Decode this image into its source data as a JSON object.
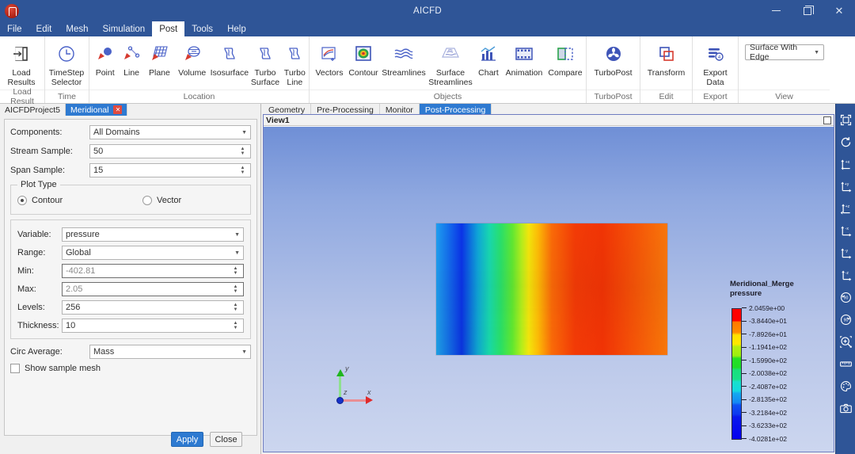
{
  "window": {
    "title": "AICFD",
    "logo_icon": "app-logo-icon",
    "minimize_label": "Minimize",
    "maximize_label": "Restore",
    "close_label": "Close"
  },
  "menubar": {
    "items": [
      {
        "label": "File",
        "active": false
      },
      {
        "label": "Edit",
        "active": false
      },
      {
        "label": "Mesh",
        "active": false
      },
      {
        "label": "Simulation",
        "active": false
      },
      {
        "label": "Post",
        "active": true
      },
      {
        "label": "Tools",
        "active": false
      },
      {
        "label": "Help",
        "active": false
      }
    ]
  },
  "ribbon": {
    "groups": [
      {
        "label": "Load Result",
        "buttons": [
          {
            "label": "Load\nResults",
            "label_l1": "Load",
            "label_l2": "Results",
            "icon": "load-results-icon"
          }
        ]
      },
      {
        "label": "Time",
        "buttons": [
          {
            "label_l1": "TimeStep",
            "label_l2": "Selector",
            "icon": "timestep-selector-icon"
          }
        ]
      },
      {
        "label": "Location",
        "buttons": [
          {
            "label_l1": "Point",
            "label_l2": "",
            "icon": "point-icon"
          },
          {
            "label_l1": "Line",
            "label_l2": "",
            "icon": "line-icon"
          },
          {
            "label_l1": "Plane",
            "label_l2": "",
            "icon": "plane-icon"
          },
          {
            "label_l1": "Volume",
            "label_l2": "",
            "icon": "volume-icon"
          },
          {
            "label_l1": "Isosurface",
            "label_l2": "",
            "icon": "isosurface-icon"
          },
          {
            "label_l1": "Turbo",
            "label_l2": "Surface",
            "icon": "turbo-surface-icon"
          },
          {
            "label_l1": "Turbo",
            "label_l2": "Line",
            "icon": "turbo-line-icon"
          }
        ]
      },
      {
        "label": "Objects",
        "buttons": [
          {
            "label_l1": "Vectors",
            "label_l2": "",
            "icon": "vectors-icon"
          },
          {
            "label_l1": "Contour",
            "label_l2": "",
            "icon": "contour-icon"
          },
          {
            "label_l1": "Streamlines",
            "label_l2": "",
            "icon": "streamlines-icon"
          },
          {
            "label_l1": "Surface",
            "label_l2": "Streamlines",
            "icon": "surface-streamlines-icon"
          },
          {
            "label_l1": "Chart",
            "label_l2": "",
            "icon": "chart-icon"
          },
          {
            "label_l1": "Animation",
            "label_l2": "",
            "icon": "animation-icon"
          },
          {
            "label_l1": "Compare",
            "label_l2": "",
            "icon": "compare-icon"
          }
        ]
      },
      {
        "label": "TurboPost",
        "buttons": [
          {
            "label_l1": "TurboPost",
            "label_l2": "",
            "icon": "turbopost-icon"
          }
        ]
      },
      {
        "label": "Edit",
        "buttons": [
          {
            "label_l1": "Transform",
            "label_l2": "",
            "icon": "transform-icon"
          }
        ]
      },
      {
        "label": "Export",
        "buttons": [
          {
            "label_l1": "Export",
            "label_l2": "Data",
            "icon": "export-data-icon"
          }
        ]
      },
      {
        "label": "View",
        "buttons": [],
        "select": {
          "value": "Surface With Edge",
          "caret_icon": "chevron-down-icon"
        }
      }
    ]
  },
  "left_panel": {
    "tabs": [
      {
        "label": "AICFDProject5",
        "active": false,
        "closable": false
      },
      {
        "label": "Meridional",
        "active": true,
        "closable": true,
        "close_icon": "close-icon"
      }
    ],
    "fields": [
      {
        "name": "components",
        "label": "Components:",
        "value": "All Domains",
        "type": "combo"
      },
      {
        "name": "stream-sample",
        "label": "Stream Sample:",
        "value": "50",
        "type": "spin"
      },
      {
        "name": "span-sample",
        "label": "Span Sample:",
        "value": "15",
        "type": "spin"
      }
    ],
    "plot_type": {
      "legend": "Plot Type",
      "options": [
        {
          "label": "Contour",
          "selected": true
        },
        {
          "label": "Vector",
          "selected": false
        }
      ]
    },
    "contour_fields": [
      {
        "name": "variable",
        "label": "Variable:",
        "value": "pressure",
        "type": "combo"
      },
      {
        "name": "range",
        "label": "Range:",
        "value": "Global",
        "type": "combo"
      },
      {
        "name": "min",
        "label": "Min:",
        "value": "-402.81",
        "type": "spin",
        "dim": true
      },
      {
        "name": "max",
        "label": "Max:",
        "value": "2.05",
        "type": "spin",
        "dim": true
      },
      {
        "name": "levels",
        "label": "Levels:",
        "value": "256",
        "type": "spin"
      },
      {
        "name": "thickness",
        "label": "Thickness:",
        "value": "10",
        "type": "spin"
      }
    ],
    "circ_average": {
      "label": "Circ Average:",
      "value": "Mass",
      "type": "combo"
    },
    "show_sample_mesh": {
      "label": "Show sample mesh",
      "checked": false
    },
    "buttons": {
      "apply": "Apply",
      "close": "Close"
    }
  },
  "viewport": {
    "tabs": [
      {
        "label": "Geometry",
        "active": false
      },
      {
        "label": "Pre-Processing",
        "active": false
      },
      {
        "label": "Monitor",
        "active": false
      },
      {
        "label": "Post-Processing",
        "active": true
      }
    ],
    "view_title": "View1",
    "maximize_icon": "view-maximize-icon",
    "axes": [
      {
        "label": "y",
        "color": "#1fb51f"
      },
      {
        "label": "x",
        "color": "#e02b2b"
      },
      {
        "label": "z",
        "color": "#1632c8"
      }
    ]
  },
  "chart_data": {
    "type": "heatmap",
    "title": "Meridional_Merge",
    "subtitle": "pressure",
    "colormap": "jet",
    "unit": "",
    "legend_position": "right",
    "levels": 256,
    "range_mode": "Global",
    "min": -402.81,
    "max": 2.05,
    "tick_labels": [
      "2.0459e+00",
      "-3.8440e+01",
      "-7.8926e+01",
      "-1.1941e+02",
      "-1.5990e+02",
      "-2.0038e+02",
      "-2.4087e+02",
      "-2.8135e+02",
      "-3.2184e+02",
      "-3.6233e+02",
      "-4.0281e+02"
    ],
    "tick_values": [
      2.0459,
      -38.44,
      -78.926,
      -119.41,
      -159.9,
      -200.38,
      -240.87,
      -281.35,
      -321.84,
      -362.33,
      -402.81
    ],
    "tick_colors": [
      "#ff0000",
      "#ff8c00",
      "#ffe000",
      "#b4ee10",
      "#24e024",
      "#18e07c",
      "#18e0cc",
      "#14b4f0",
      "#1470f4",
      "#0c30f0",
      "#0400ee"
    ],
    "description": "Meridional pressure contour: low pressure (blue) at the left inlet rising sharply through a green/yellow band to high pressure (red/orange) across the remaining domain"
  },
  "right_toolbar": {
    "tools": [
      {
        "name": "fit-view-icon",
        "label": "Fit View"
      },
      {
        "name": "rotate-view-icon",
        "label": "Rotate"
      },
      {
        "name": "view-plus-x-icon",
        "label": "+X View"
      },
      {
        "name": "view-plus-y-icon",
        "label": "+Y View"
      },
      {
        "name": "view-plus-z-icon",
        "label": "+Z View"
      },
      {
        "name": "view-minus-x-icon",
        "label": "-X View"
      },
      {
        "name": "view-minus-y-icon",
        "label": "-Y View"
      },
      {
        "name": "view-minus-z-icon",
        "label": "-Z View"
      },
      {
        "name": "rotate-ccw-90-icon",
        "label": "Rotate 90 CCW"
      },
      {
        "name": "rotate-cw-90-icon",
        "label": "Rotate 90 CW"
      },
      {
        "name": "zoom-box-icon",
        "label": "Zoom Box"
      },
      {
        "name": "ruler-icon",
        "label": "Measure"
      },
      {
        "name": "palette-icon",
        "label": "Color Settings"
      },
      {
        "name": "camera-icon",
        "label": "Screenshot"
      }
    ]
  }
}
